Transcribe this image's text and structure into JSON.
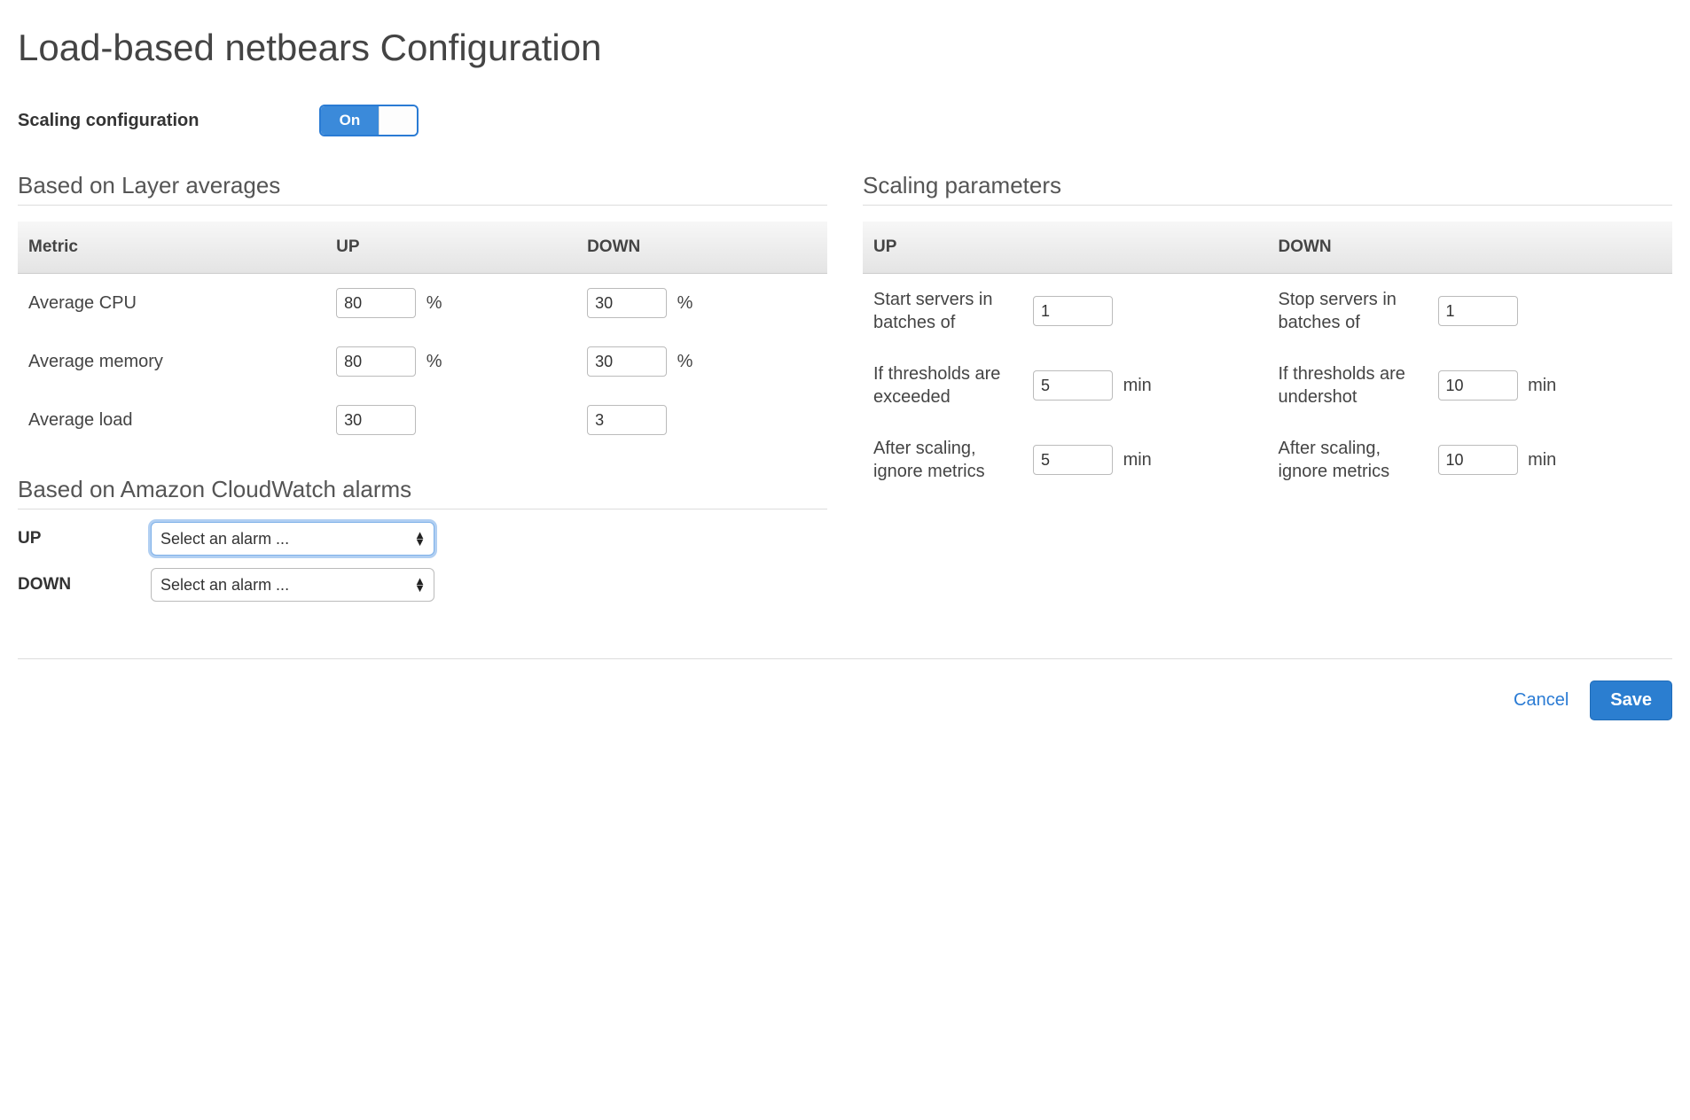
{
  "page": {
    "title": "Load-based netbears Configuration",
    "scaling_config_label": "Scaling configuration",
    "toggle_state": "On"
  },
  "layer_averages": {
    "title": "Based on Layer averages",
    "header_metric": "Metric",
    "header_up": "UP",
    "header_down": "DOWN",
    "rows": {
      "cpu": {
        "label": "Average CPU",
        "up": "80",
        "down": "30",
        "unit": "%"
      },
      "memory": {
        "label": "Average memory",
        "up": "80",
        "down": "30",
        "unit": "%"
      },
      "load": {
        "label": "Average load",
        "up": "30",
        "down": "3",
        "unit": ""
      }
    }
  },
  "scaling_params": {
    "title": "Scaling parameters",
    "header_up": "UP",
    "header_down": "DOWN",
    "rows": {
      "batches": {
        "up_label": "Start servers in batches of",
        "up_value": "1",
        "up_unit": "",
        "down_label": "Stop servers in batches of",
        "down_value": "1",
        "down_unit": ""
      },
      "threshold": {
        "up_label": "If thresholds are exceeded",
        "up_value": "5",
        "up_unit": "min",
        "down_label": "If thresholds are undershot",
        "down_value": "10",
        "down_unit": "min"
      },
      "ignore": {
        "up_label": "After scaling, ignore metrics",
        "up_value": "5",
        "up_unit": "min",
        "down_label": "After scaling, ignore metrics",
        "down_value": "10",
        "down_unit": "min"
      }
    }
  },
  "cloudwatch": {
    "title": "Based on Amazon CloudWatch alarms",
    "up_label": "UP",
    "down_label": "DOWN",
    "select_placeholder": "Select an alarm ..."
  },
  "footer": {
    "cancel": "Cancel",
    "save": "Save"
  }
}
